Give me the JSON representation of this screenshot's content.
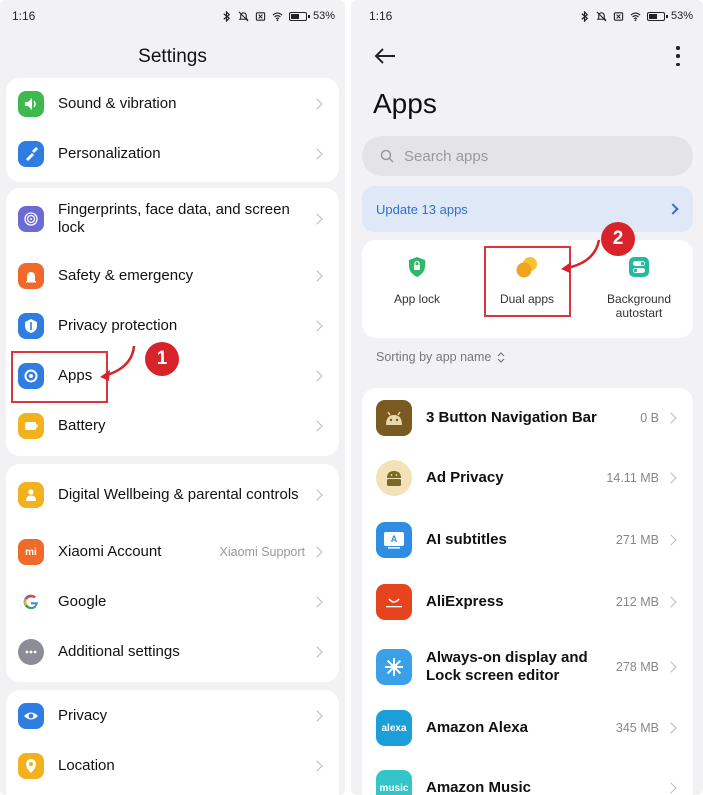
{
  "status": {
    "time": "1:16",
    "battery": "53"
  },
  "left": {
    "title": "Settings",
    "group1": [
      {
        "label": "Sound & vibration",
        "color": "#3db94d",
        "icon": "speaker-icon"
      },
      {
        "label": "Personalization",
        "color": "#2f7de1",
        "icon": "brush-icon"
      }
    ],
    "group2": [
      {
        "label": "Fingerprints, face data, and screen lock",
        "color": "#6b6bd6",
        "icon": "fingerprint-icon"
      },
      {
        "label": "Safety & emergency",
        "color": "#f0692b",
        "icon": "emergency-icon"
      },
      {
        "label": "Privacy protection",
        "color": "#2f7de1",
        "icon": "shield-icon"
      },
      {
        "label": "Apps",
        "color": "#2f7de1",
        "icon": "apps-gear-icon"
      },
      {
        "label": "Battery",
        "color": "#f2b21d",
        "icon": "battery-icon"
      }
    ],
    "group3": [
      {
        "label": "Digital Wellbeing & parental controls",
        "color": "#f2b21d",
        "icon": "wellbeing-icon"
      },
      {
        "label": "Xiaomi Account",
        "value": "Xiaomi Support",
        "color": "#f06a2a",
        "icon": "mi-icon"
      },
      {
        "label": "Google",
        "color": "#ffffff",
        "icon": "google-icon"
      },
      {
        "label": "Additional settings",
        "color": "#8c8c96",
        "icon": "more-dots-icon"
      }
    ],
    "group4": [
      {
        "label": "Privacy",
        "color": "#2f7de1",
        "icon": "eye-icon"
      },
      {
        "label": "Location",
        "color": "#f2b21d",
        "icon": "location-pin-icon"
      }
    ],
    "step_badge": "1"
  },
  "right": {
    "title": "Apps",
    "search_placeholder": "Search apps",
    "update_label": "Update 13 apps",
    "tools": [
      {
        "label": "App lock",
        "icon": "lock-shield-icon"
      },
      {
        "label": "Dual apps",
        "icon": "dual-apps-icon"
      },
      {
        "label": "Background autostart",
        "icon": "autostart-icon"
      }
    ],
    "step_badge": "2",
    "sort_label": "Sorting by app name",
    "apps": [
      {
        "name": "3 Button Navigation Bar",
        "size": "0 B",
        "color": "#7a5a20",
        "icon": "android-grid-icon"
      },
      {
        "name": "Ad Privacy",
        "size": "14.11 MB",
        "color": "#f3e2b8",
        "icon": "android-icon"
      },
      {
        "name": "AI subtitles",
        "size": "271 MB",
        "color": "#2f8de4",
        "icon": "subtitles-icon"
      },
      {
        "name": "AliExpress",
        "size": "212 MB",
        "color": "#e8431f",
        "icon": "aliexpress-icon"
      },
      {
        "name": "Always-on display and Lock screen editor",
        "size": "278 MB",
        "color": "#3aa0e8",
        "icon": "aod-icon"
      },
      {
        "name": "Amazon Alexa",
        "size": "345 MB",
        "color": "#1b9fd8",
        "icon": "alexa-icon",
        "text": "alexa"
      },
      {
        "name": "Amazon Music",
        "size": "",
        "color": "#32c6c8",
        "icon": "amazon-music-icon",
        "text": "music"
      }
    ]
  }
}
